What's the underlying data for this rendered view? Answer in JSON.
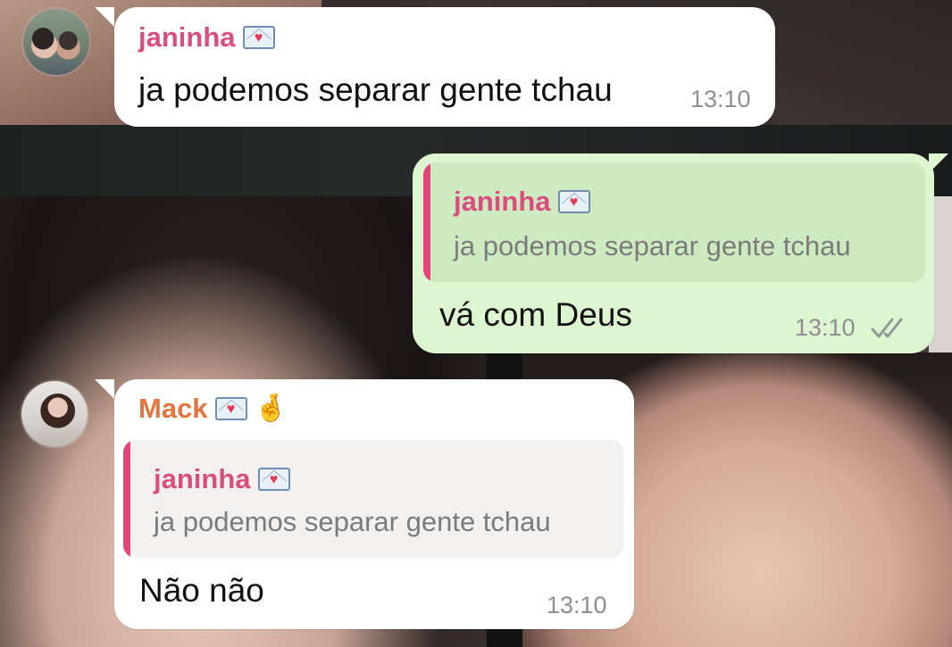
{
  "messages": [
    {
      "sender": "janinha",
      "sender_badge_icon": "love-letter-icon",
      "text": "ja podemos separar gente tchau",
      "time": "13:10"
    },
    {
      "reply_to": {
        "sender": "janinha",
        "sender_badge_icon": "love-letter-icon",
        "text": "ja podemos separar gente tchau"
      },
      "text": "vá com Deus",
      "time": "13:10",
      "status_icon": "double-check-read-icon"
    },
    {
      "sender": "Mack",
      "sender_badge_icons": [
        "love-letter-icon",
        "crossed-fingers-icon"
      ],
      "reply_to": {
        "sender": "janinha",
        "sender_badge_icon": "love-letter-icon",
        "text": "ja podemos separar gente tchau"
      },
      "text": "Não não",
      "time": "13:10"
    }
  ],
  "colors": {
    "incoming_bubble": "#ffffff",
    "outgoing_bubble": "#ddf5d1",
    "name_pink": "#d94e7e",
    "name_orange": "#e2753e",
    "quote_bar": "#e0467b",
    "timestamp": "#8e8e8e"
  }
}
